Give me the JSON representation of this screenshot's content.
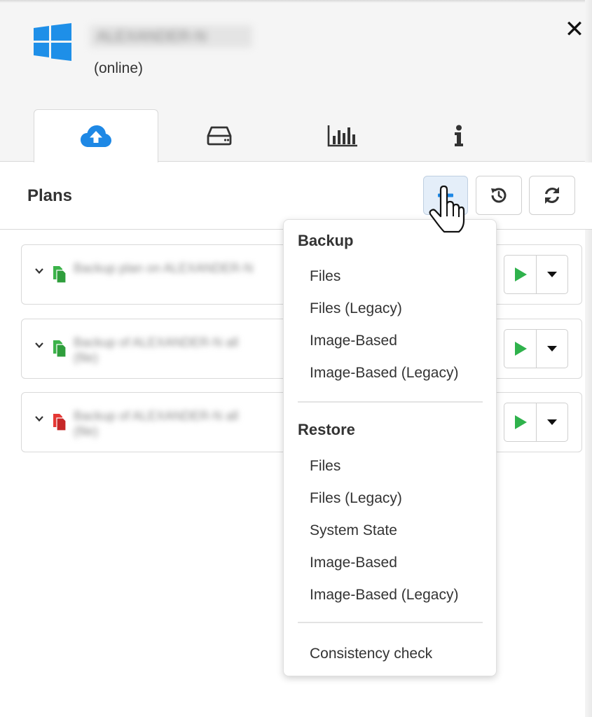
{
  "header": {
    "host_name": "ALEXANDER-N",
    "status": "(online)",
    "close_glyph": "✕"
  },
  "tabs": [
    {
      "icon": "cloud-upload-icon",
      "active": true
    },
    {
      "icon": "hard-drive-icon",
      "active": false
    },
    {
      "icon": "bar-chart-icon",
      "active": false
    },
    {
      "icon": "info-icon",
      "active": false
    }
  ],
  "plans": {
    "title": "Plans",
    "toolbar_icons": [
      "plus-icon",
      "history-icon",
      "refresh-icon"
    ],
    "items": [
      {
        "name_line1": "Backup plan on ALEXANDER-N",
        "name_line2": "",
        "status_color": "#3cb34a"
      },
      {
        "name_line1": "Backup of ALEXANDER-N all",
        "name_line2": "(file)",
        "status_color": "#3cb34a"
      },
      {
        "name_line1": "Backup of ALEXANDER-N all",
        "name_line2": "(file)",
        "status_color": "#e53935"
      }
    ]
  },
  "menu": {
    "backup_header": "Backup",
    "backup_items": [
      "Files",
      "Files (Legacy)",
      "Image-Based",
      "Image-Based (Legacy)"
    ],
    "restore_header": "Restore",
    "restore_items": [
      "Files",
      "Files (Legacy)",
      "System State",
      "Image-Based",
      "Image-Based (Legacy)"
    ],
    "other_items": [
      "Consistency check"
    ]
  },
  "colors": {
    "accent_blue": "#1e88e5",
    "play_green": "#2fb24c",
    "windows_blue": "#1e8fe8"
  }
}
